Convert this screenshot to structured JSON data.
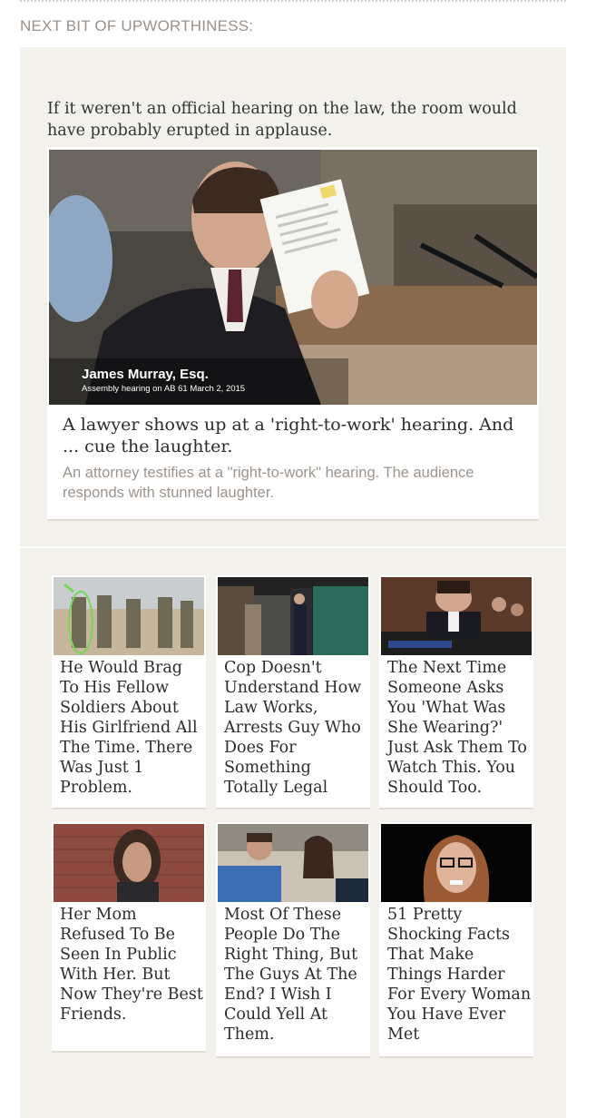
{
  "section": {
    "heading": "NEXT BIT OF UPWORTHINESS:"
  },
  "featured": {
    "lead": "If it weren't an official hearing on the law, the room would have probably erupted in applause.",
    "image": {
      "caption_name": "James Murray, Esq.",
      "caption_sub": "Assembly hearing on AB 61  March 2, 2015"
    },
    "title": "A lawyer shows up at a 'right-to-work' hearing. And ... cue the laughter.",
    "description": "An attorney testifies at a \"right-to-work\" hearing. The audience responds with stunned laughter."
  },
  "grid": {
    "items": [
      {
        "title": "He Would Brag To His Fellow Soldiers About His Girlfriend All The Time. There Was Just 1 Problem."
      },
      {
        "title": "Cop Doesn't Understand How Law Works, Arrests Guy Who Does For Something Totally Legal"
      },
      {
        "title": "The Next Time Someone Asks You 'What Was She Wearing?' Just Ask Them To Watch This. You Should Too."
      },
      {
        "title": "Her Mom Refused To Be Seen In Public With Her. But Now They're Best Friends."
      },
      {
        "title": "Most Of These People Do The Right Thing, But The Guys At The End? I Wish I Could Yell At Them."
      },
      {
        "title": "51 Pretty Shocking Facts That Make Things Harder For Every Woman You Have Ever Met"
      }
    ]
  }
}
